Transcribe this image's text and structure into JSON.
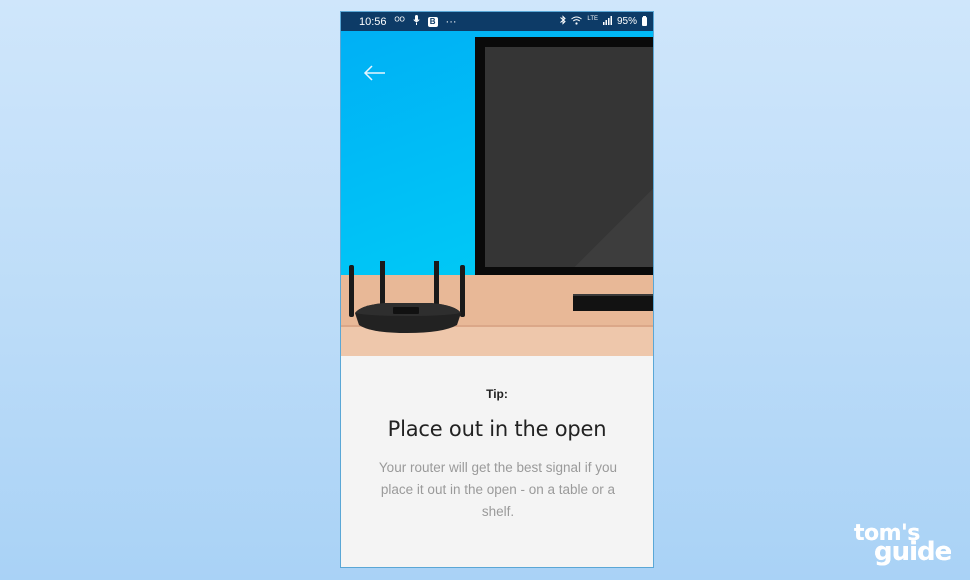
{
  "status_bar": {
    "time": "10:56",
    "left_icons": [
      "voicemail-icon",
      "microphone-icon"
    ],
    "badge": "B",
    "more": "···",
    "network": "LTE",
    "battery": "95%",
    "right_icons": [
      "bluetooth-icon",
      "wifi-icon",
      "signal-icon",
      "battery-icon"
    ]
  },
  "nav": {
    "back_icon": "arrow-left-icon"
  },
  "tip": {
    "label": "Tip:",
    "title": "Place out in the open",
    "description": "Your router will get the best signal if you place it out in the open - on a table or a shelf."
  },
  "watermark": {
    "line1": "tom's",
    "line2": "guide"
  },
  "colors": {
    "status_bar": "#0d3b67",
    "wall": "#00b5f7",
    "table": "#e8b897",
    "content_bg": "#f4f4f4"
  }
}
